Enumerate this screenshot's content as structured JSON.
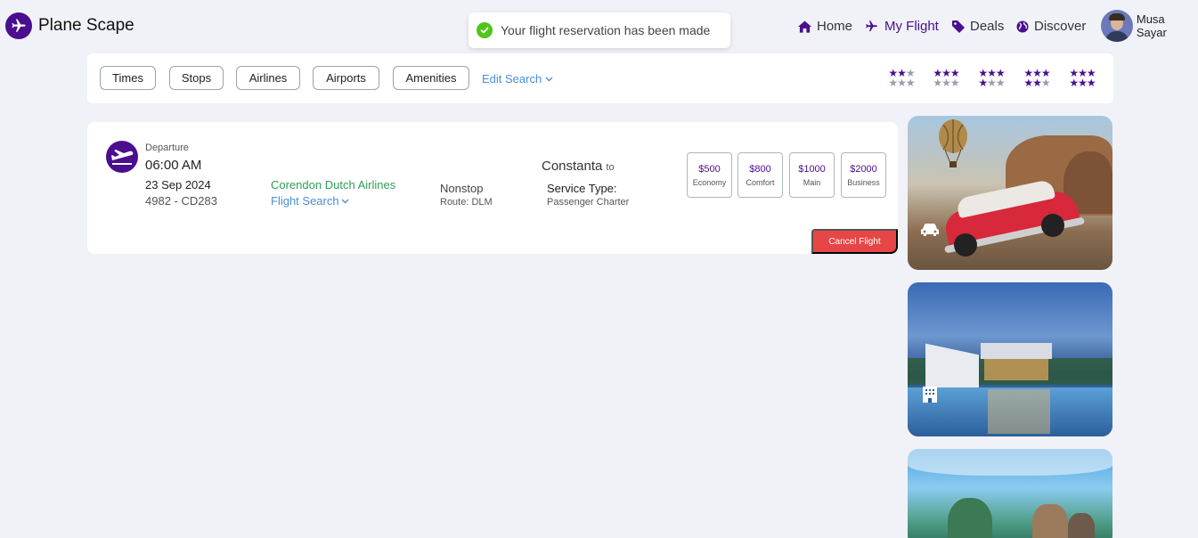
{
  "brand": {
    "name": "Plane Scape"
  },
  "toast": {
    "message": "Your flight reservation has been made"
  },
  "nav": {
    "home": "Home",
    "my_flight": "My Flight",
    "deals": "Deals",
    "discover": "Discover"
  },
  "user": {
    "name": "Musa Sayar"
  },
  "filters": {
    "times": "Times",
    "stops": "Stops",
    "airlines": "Airlines",
    "airports": "Airports",
    "amenities": "Amenities",
    "edit_search": "Edit Search"
  },
  "star_ratings": [
    2,
    3,
    4,
    5,
    6
  ],
  "flight": {
    "label": "Departure",
    "time": "06:00 AM",
    "date": "23 Sep 2024",
    "code": "4982 - CD283",
    "airline": "Corendon Dutch Airlines",
    "flight_search": "Flight Search",
    "stops": "Nonstop",
    "route": "Route: DLM",
    "city": "Constanta",
    "city_suffix": "to",
    "service_label": "Service Type:",
    "service_value": "Passenger Charter",
    "prices": [
      {
        "amount": "$500",
        "class": "Economy"
      },
      {
        "amount": "$800",
        "class": "Comfort"
      },
      {
        "amount": "$1000",
        "class": "Main"
      },
      {
        "amount": "$2000",
        "class": "Business"
      }
    ],
    "cancel": "Cancel Flight"
  },
  "promos": [
    {
      "icon": "car-icon"
    },
    {
      "icon": "hotel-icon"
    },
    {
      "icon": "beach-icon"
    }
  ],
  "colors": {
    "brand_purple": "#4a0e8f",
    "airline_green": "#2f9e57",
    "link_blue": "#4a8fd6",
    "cancel_red": "#e74646",
    "success_green": "#52c41a",
    "background": "#f0f2f8"
  }
}
